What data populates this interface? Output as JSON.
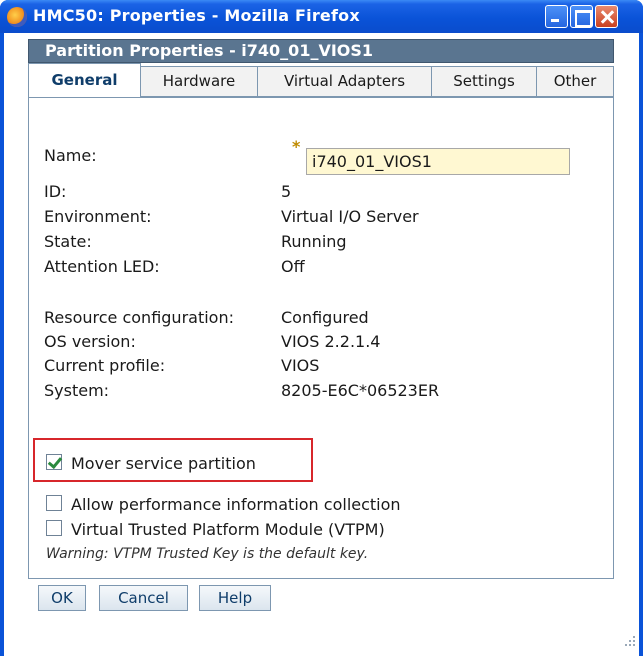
{
  "window": {
    "title": "HMC50: Properties - Mozilla Firefox",
    "app_icon": "firefox-icon"
  },
  "header": {
    "title": "Partition Properties - i740_01_VIOS1"
  },
  "tabs": [
    {
      "label": "General",
      "active": true
    },
    {
      "label": "Hardware",
      "active": false
    },
    {
      "label": "Virtual Adapters",
      "active": false
    },
    {
      "label": "Settings",
      "active": false
    },
    {
      "label": "Other",
      "active": false
    }
  ],
  "general": {
    "name_label": "Name:",
    "required_marker": "*",
    "name_value": "i740_01_VIOS1",
    "id_label": "ID:",
    "id_value": "5",
    "environment_label": "Environment:",
    "environment_value": "Virtual I/O Server",
    "state_label": "State:",
    "state_value": "Running",
    "attention_label": "Attention LED:",
    "attention_value": "Off",
    "resource_label": "Resource configuration:",
    "resource_value": "Configured",
    "os_label": "OS version:",
    "os_value": "VIOS 2.2.1.4",
    "profile_label": "Current profile:",
    "profile_value": "VIOS",
    "system_label": "System:",
    "system_value": "8205-E6C*06523ER"
  },
  "options": {
    "mover_label": "Mover service partition",
    "mover_checked": true,
    "perf_label": "Allow performance information collection",
    "perf_checked": false,
    "vtpm_label": "Virtual Trusted Platform Module (VTPM)",
    "vtpm_checked": false,
    "warning": "Warning: VTPM Trusted Key is the default key."
  },
  "buttons": {
    "ok": "OK",
    "cancel": "Cancel",
    "help": "Help"
  },
  "colors": {
    "highlight": "#d7262b",
    "header": "#5a7590",
    "titlebar": "#0a53d8"
  }
}
